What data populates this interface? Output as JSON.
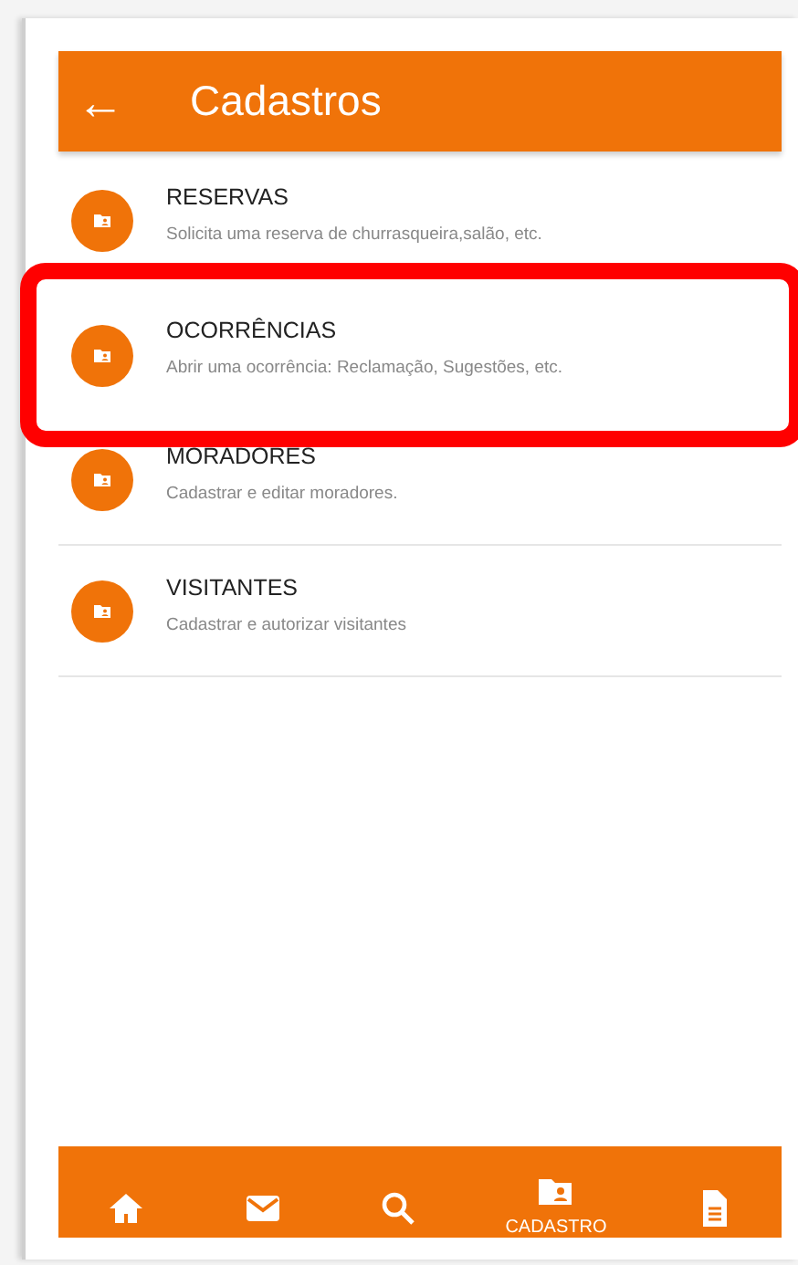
{
  "header": {
    "back_icon": "←",
    "title": "Cadastros"
  },
  "items": [
    {
      "title": "RESERVAS",
      "subtitle": "Solicita uma reserva de churrasqueira,salão, etc.",
      "highlighted": false,
      "divider": false
    },
    {
      "title": "OCORRÊNCIAS",
      "subtitle": "Abrir uma ocorrência: Reclamação, Sugestões, etc.",
      "highlighted": true,
      "divider": false
    },
    {
      "title": "MORADORES",
      "subtitle": "Cadastrar e editar moradores.",
      "highlighted": false,
      "divider": true
    },
    {
      "title": "VISITANTES",
      "subtitle": "Cadastrar e autorizar visitantes",
      "highlighted": false,
      "divider": true
    }
  ],
  "bottom_nav": [
    {
      "kind": "home",
      "selected": false
    },
    {
      "kind": "mail",
      "selected": false
    },
    {
      "kind": "search",
      "selected": false
    },
    {
      "kind": "folder",
      "selected": true,
      "label": "CADASTRO"
    },
    {
      "kind": "document",
      "selected": false
    }
  ]
}
